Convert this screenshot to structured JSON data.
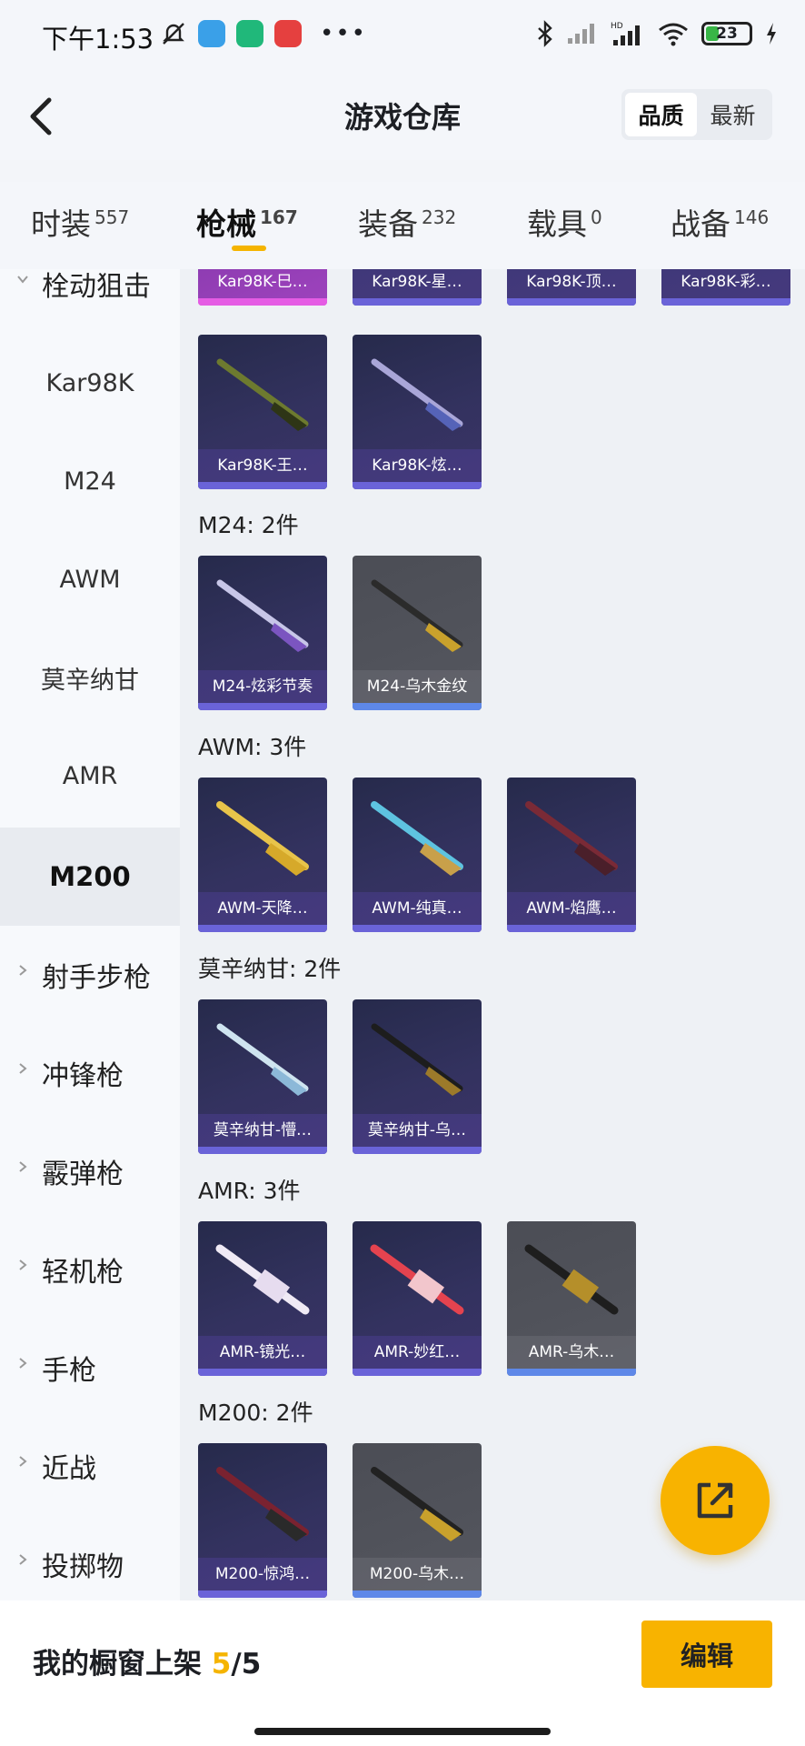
{
  "status_bar": {
    "time": "下午1:53",
    "battery": "23",
    "icons": [
      "mute-icon",
      "wallet-icon",
      "app-icon",
      "news-icon",
      "more-icon",
      "bluetooth-icon",
      "signal-icon",
      "hd-signal-icon",
      "wifi-icon",
      "battery-icon",
      "charging-icon"
    ]
  },
  "header": {
    "title": "游戏仓库",
    "sort_options": [
      "品质",
      "最新"
    ],
    "sort_selected": "品质"
  },
  "tabs": [
    {
      "label": "时装",
      "count": "557"
    },
    {
      "label": "枪械",
      "count": "167"
    },
    {
      "label": "装备",
      "count": "232"
    },
    {
      "label": "载具",
      "count": "0"
    },
    {
      "label": "战备",
      "count": "146"
    }
  ],
  "active_tab": "枪械",
  "sidebar": {
    "expanded_category": "栓动狙击",
    "sub_items": [
      "Kar98K",
      "M24",
      "AWM",
      "莫辛纳甘",
      "AMR",
      "M200"
    ],
    "active_item": "M200",
    "categories": [
      "射手步枪",
      "冲锋枪",
      "霰弹枪",
      "轻机枪",
      "手枪",
      "近战",
      "投掷物"
    ]
  },
  "content": {
    "top_partial_cards": [
      "Kar98K-巳…",
      "Kar98K-星…",
      "Kar98K-顶…",
      "Kar98K-彩…"
    ],
    "kar_cards": [
      "Kar98K-王…",
      "Kar98K-炫…"
    ],
    "sections": [
      {
        "title": "M24: 2件",
        "cards": [
          "M24-炫彩节奏",
          "M24-乌木金纹"
        ]
      },
      {
        "title": "AWM: 3件",
        "cards": [
          "AWM-天降…",
          "AWM-纯真…",
          "AWM-焰鹰…"
        ]
      },
      {
        "title": "莫辛纳甘: 2件",
        "cards": [
          "莫辛纳甘-懵…",
          "莫辛纳甘-乌…"
        ]
      },
      {
        "title": "AMR: 3件",
        "cards": [
          "AMR-镜光…",
          "AMR-妙红…",
          "AMR-乌木…"
        ]
      },
      {
        "title": "M200: 2件",
        "cards": [
          "M200-惊鸿…",
          "M200-乌木…"
        ]
      }
    ]
  },
  "bottom": {
    "shelf_label": "我的橱窗上架",
    "shelf_count": "5",
    "shelf_sep": "/",
    "shelf_total": "5",
    "edit_label": "编辑"
  },
  "colors": {
    "accent": "#f8b300",
    "purple_rarity": "#6a63d8",
    "gray_rarity": "#5e88e8"
  }
}
